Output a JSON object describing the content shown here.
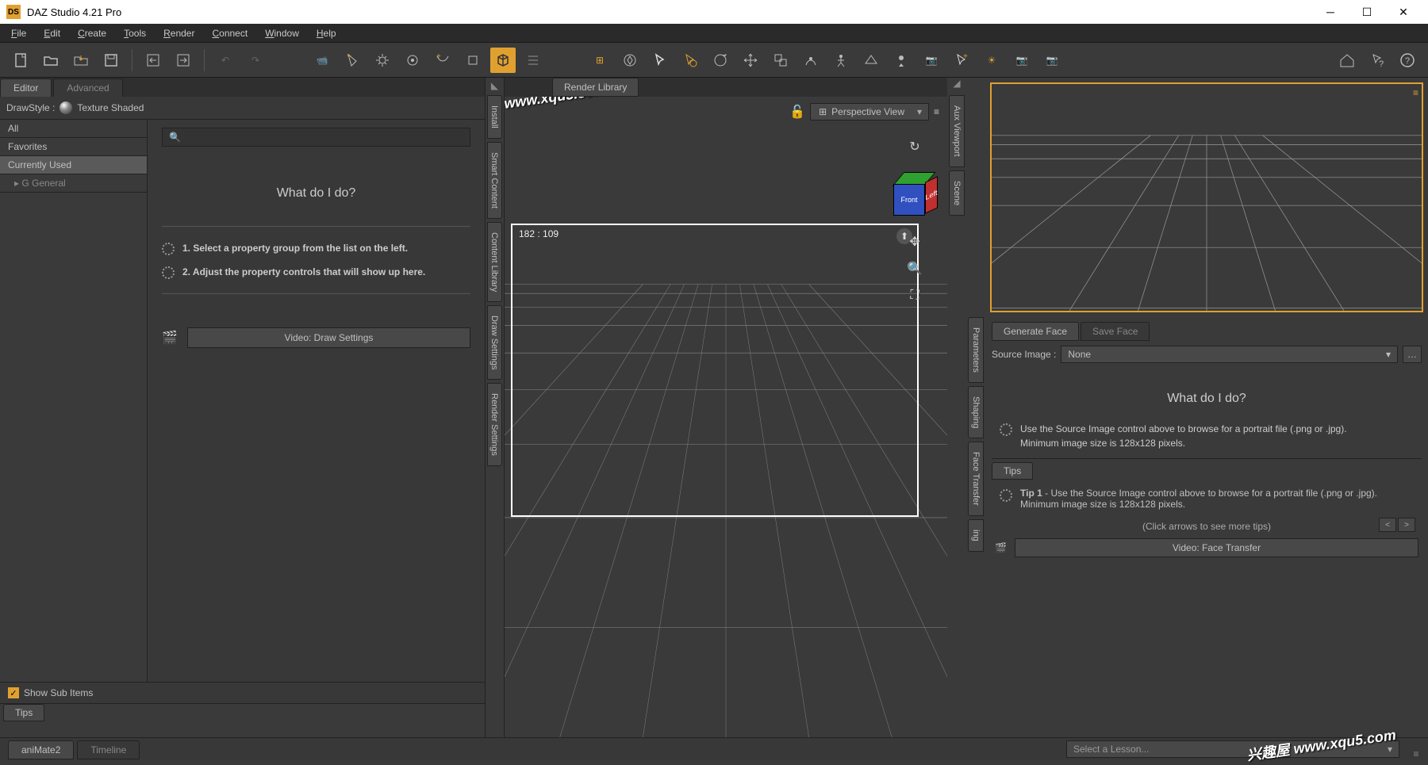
{
  "window": {
    "title": "DAZ Studio 4.21 Pro",
    "logo": "DS"
  },
  "menubar": [
    "File",
    "Edit",
    "Create",
    "Tools",
    "Render",
    "Connect",
    "Window",
    "Help"
  ],
  "left": {
    "tabs": [
      "Editor",
      "Advanced"
    ],
    "drawstyle_label": "DrawStyle :",
    "drawstyle_value": "Texture Shaded",
    "filters": [
      "All",
      "Favorites",
      "Currently Used",
      "G General"
    ],
    "help_title": "What do I do?",
    "step1": "1. Select a property group from the list on the left.",
    "step2": "2. Adjust the property controls that will show up here.",
    "video_btn": "Video: Draw Settings",
    "show_sub": "Show Sub Items",
    "tips_tab": "Tips"
  },
  "vstrip_left": [
    "Install",
    "Smart Content",
    "Content Library",
    "Draw Settings",
    "Render Settings"
  ],
  "center": {
    "tab": "Render Library",
    "view_label": "Perspective View",
    "coords": "182 : 109",
    "cube_front": "Front",
    "cube_left": "Left"
  },
  "vstrip_right_a": [
    "Aux Viewport",
    "Scene"
  ],
  "vstrip_right_b": [
    "Parameters",
    "Shaping",
    "Face Transfer",
    "ing"
  ],
  "right": {
    "tabs": [
      "Generate Face",
      "Save Face"
    ],
    "src_label": "Source Image :",
    "src_value": "None",
    "help_title": "What do I do?",
    "help_line1": "Use the Source Image control above to browse for a portrait file (.png or .jpg).",
    "help_line2": "Minimum image size is 128x128 pixels.",
    "tips_tab": "Tips",
    "tip1_bold": "Tip 1",
    "tip1": " - Use the Source Image control above to browse for a portrait file (.png or .jpg). Minimum image size is 128x128 pixels.",
    "tips_nav": "(Click arrows to see more tips)",
    "video_btn": "Video: Face Transfer"
  },
  "bottom": {
    "tabs": [
      "aniMate2",
      "Timeline"
    ],
    "lesson": "Select a Lesson..."
  },
  "watermark": "兴趣屋 www.xqu5.com"
}
